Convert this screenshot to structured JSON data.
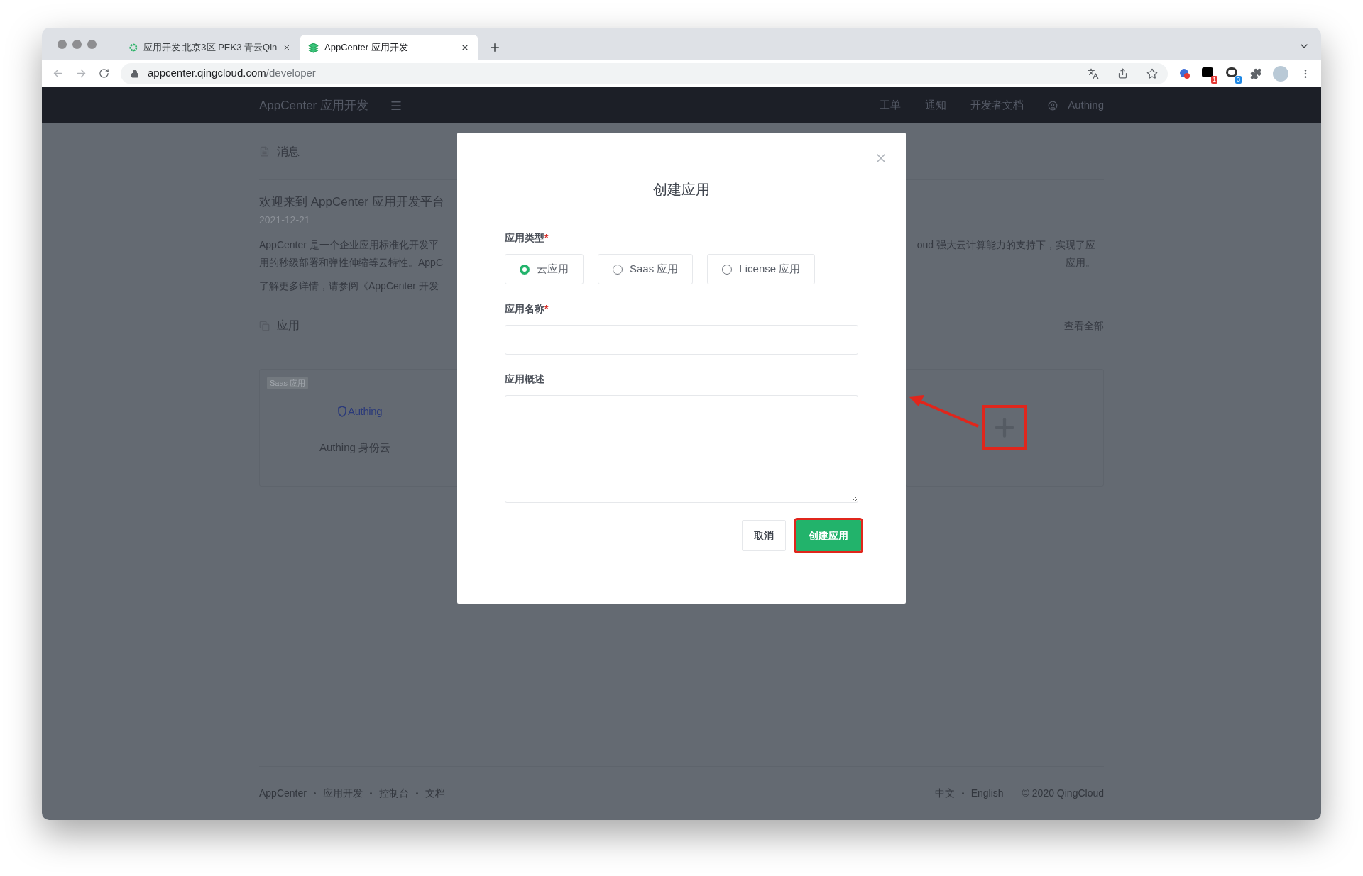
{
  "browser": {
    "tabs": [
      {
        "title": "应用开发 北京3区 PEK3 青云Qin",
        "selected": false
      },
      {
        "title": "AppCenter 应用开发",
        "selected": true
      }
    ],
    "url": {
      "host": "appcenter.qingcloud.com",
      "path": "/developer"
    },
    "extension_badges": [
      "1",
      "3"
    ]
  },
  "header": {
    "brand": "AppCenter 应用开发",
    "nav": [
      "工单",
      "通知",
      "开发者文档"
    ],
    "user": "Authing"
  },
  "messages": {
    "title": "消息",
    "post_title": "欢迎来到 AppCenter 应用开发平台",
    "date": "2021-12-21",
    "lines": [
      {
        "left": "AppCenter 是一个企业应用标准化开发平",
        "right": "oud 强大云计算能力的支持下，实现了应"
      },
      {
        "left": "用的秒级部署和弹性伸缩等云特性。AppC",
        "right": "应用。"
      },
      {
        "left": "了解更多详情，请参阅《AppCenter 开发"
      }
    ]
  },
  "apps": {
    "title": "应用",
    "view_all": "查看全部",
    "card": {
      "tag": "Saas 应用",
      "logo": "Authing",
      "name": "Authing 身份云"
    }
  },
  "dialog": {
    "title": "创建应用",
    "type_field": {
      "label": "应用类型",
      "required_mark": "*",
      "options": [
        {
          "label": "云应用",
          "selected": true
        },
        {
          "label": "Saas 应用",
          "selected": false
        },
        {
          "label": "License 应用",
          "selected": false
        }
      ]
    },
    "name_field": {
      "label": "应用名称",
      "required_mark": "*"
    },
    "description_field": {
      "label": "应用概述"
    },
    "buttons": [
      {
        "label": "取消",
        "kind": "secondary",
        "highlighted": false
      },
      {
        "label": "创建应用",
        "kind": "primary",
        "highlighted": true
      }
    ]
  },
  "footer": {
    "links": [
      "AppCenter",
      "应用开发",
      "控制台",
      "文档"
    ],
    "languages": [
      "中文",
      "English"
    ],
    "copyright": "© 2020 QingCloud"
  }
}
